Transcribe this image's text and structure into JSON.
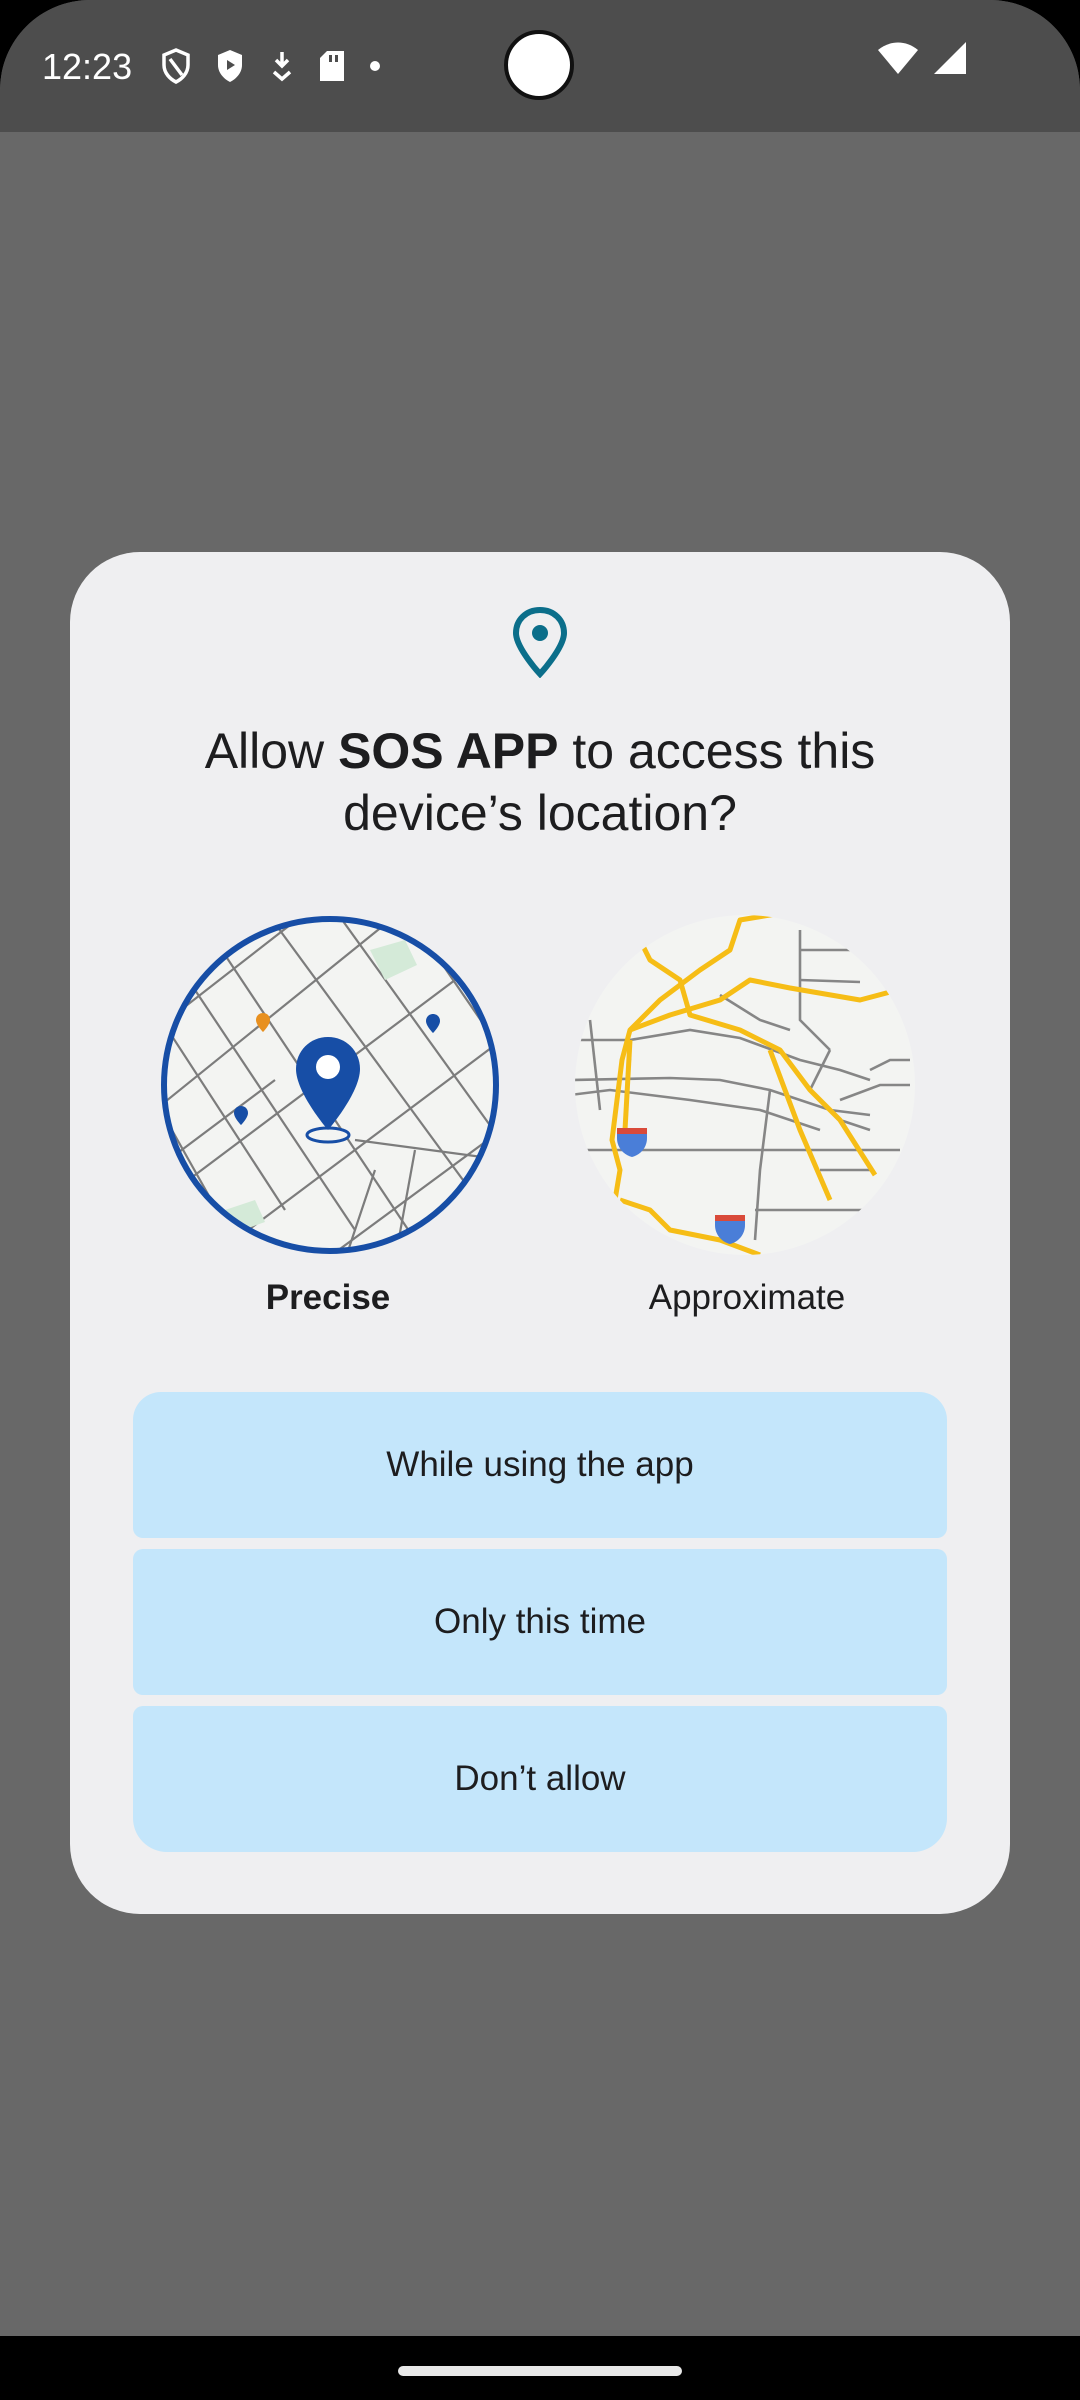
{
  "status_bar": {
    "time": "12:23",
    "icons": [
      "shield-outline-icon",
      "shield-play-icon",
      "download-icon",
      "sd-card-icon",
      "dot-icon"
    ],
    "right_icons": [
      "wifi-icon",
      "signal-icon"
    ]
  },
  "dialog": {
    "icon": "location-pin-icon",
    "title_prefix": "Allow ",
    "app_name": "SOS APP",
    "title_suffix": " to access this device’s location?",
    "options": [
      {
        "label": "Precise",
        "selected": true
      },
      {
        "label": "Approximate",
        "selected": false
      }
    ],
    "buttons": [
      {
        "label": "While using the app"
      },
      {
        "label": "Only this time"
      },
      {
        "label": "Don’t allow"
      }
    ]
  },
  "colors": {
    "accent": "#174ea6",
    "icon_teal": "#0b6e8a",
    "button_bg": "#c4e6fb",
    "dialog_bg": "#efeff1",
    "scrim": "#686868",
    "road_yellow": "#f6bd16"
  }
}
